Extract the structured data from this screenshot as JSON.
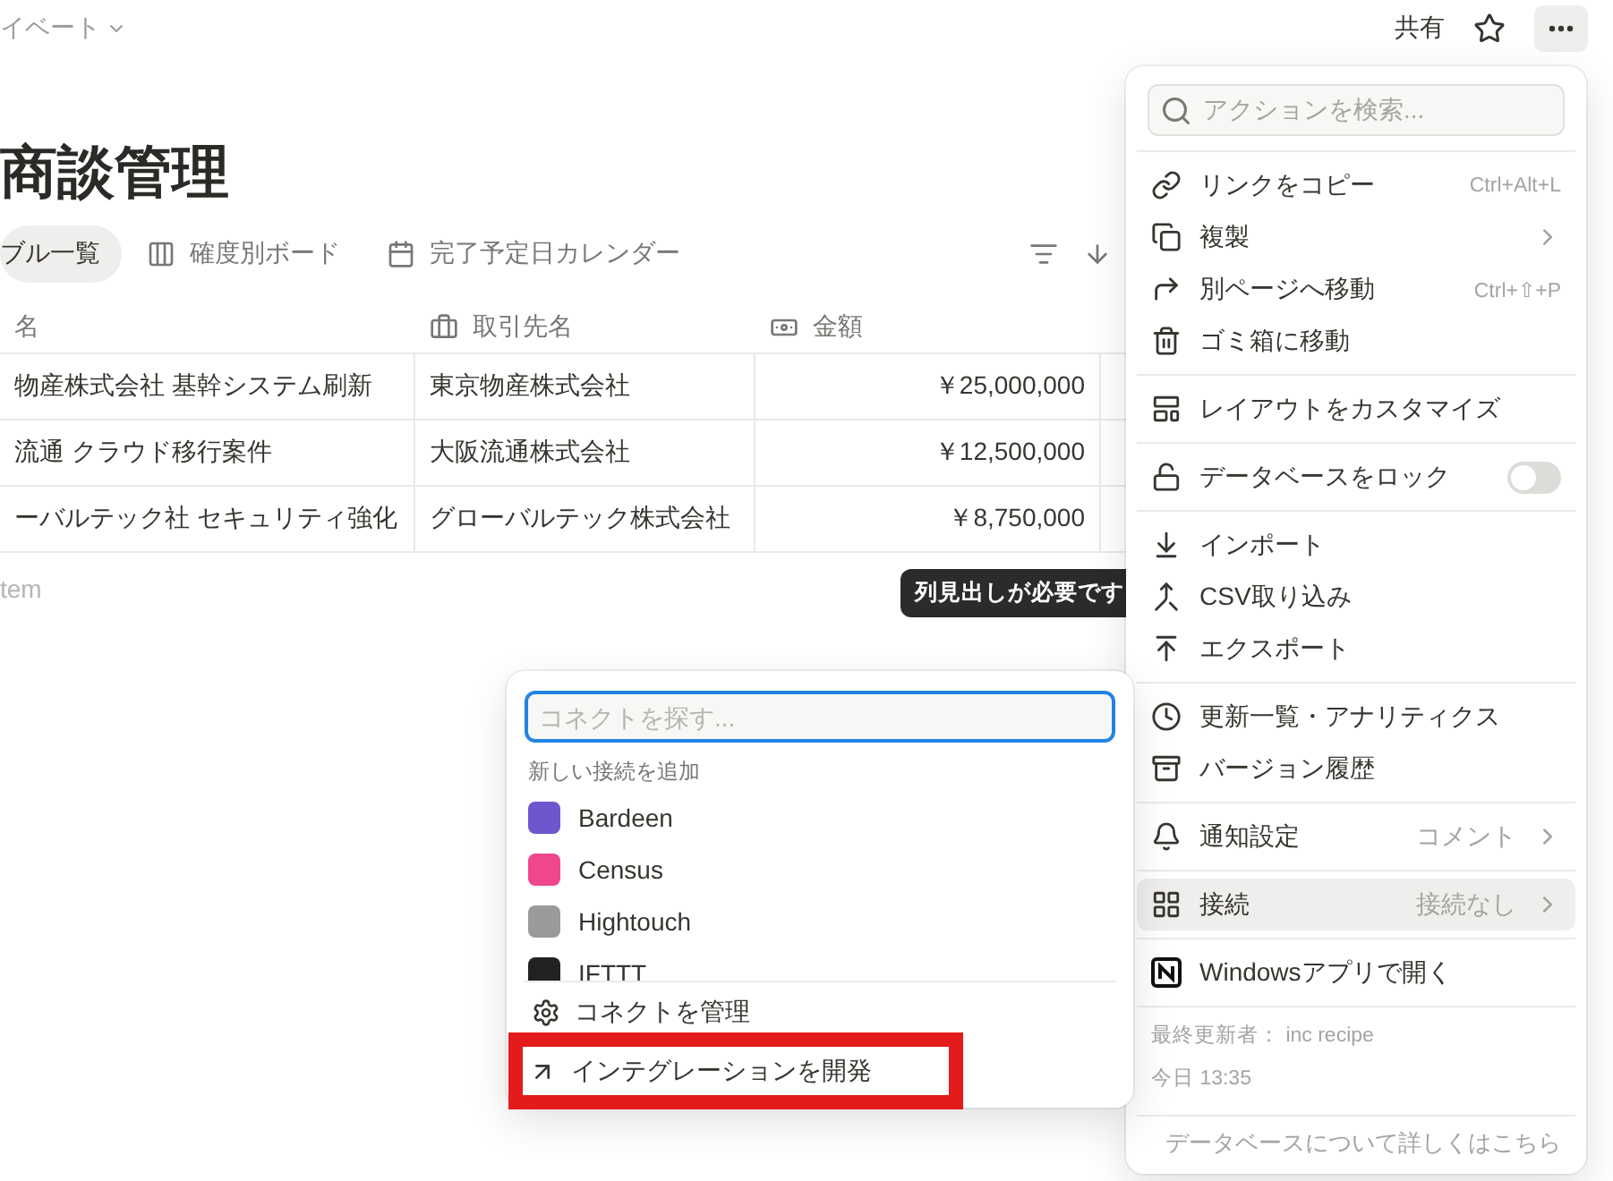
{
  "topbar": {
    "breadcrumb": "イベート",
    "share": "共有"
  },
  "title": "商談管理",
  "views": [
    {
      "label": "ブル一覧",
      "selected": true
    },
    {
      "label": "確度別ボード",
      "selected": false
    },
    {
      "label": "完了予定日カレンダー",
      "selected": false
    }
  ],
  "table": {
    "columns": [
      "名",
      "取引先名",
      "金額"
    ],
    "rows": [
      [
        "物産株式会社 基幹システム刷新",
        "東京物産株式会社",
        "￥25,000,000"
      ],
      [
        "流通 クラウド移行案件",
        "大阪流通株式会社",
        "￥12,500,000"
      ],
      [
        "ーバルテック社 セキュリティ強化",
        "グローバルテック株式会社",
        "￥8,750,000"
      ]
    ],
    "new_row": "tem"
  },
  "tooltip": "列見出しが必要です",
  "menu": {
    "search": {
      "placeholder": "アクションを検索..."
    },
    "groups": [
      [
        {
          "label": "リンクをコピー",
          "shortcut": "Ctrl+Alt+L",
          "selected": false
        },
        {
          "label": "複製",
          "submenu": true,
          "selected": false
        },
        {
          "label": "別ページへ移動",
          "shortcut": "Ctrl+⇧+P",
          "selected": false
        },
        {
          "label": "ゴミ箱に移動",
          "selected": false
        }
      ],
      [
        {
          "label": "レイアウトをカスタマイズ",
          "selected": false
        }
      ],
      [
        {
          "label": "データベースをロック",
          "kind": "toggle",
          "on": false,
          "selected": false
        }
      ],
      [
        {
          "label": "インポート",
          "selected": false
        },
        {
          "label": "CSV取り込み",
          "selected": false
        },
        {
          "label": "エクスポート",
          "selected": false
        }
      ],
      [
        {
          "label": "更新一覧・アナリティクス",
          "selected": false
        },
        {
          "label": "バージョン履歴",
          "selected": false
        }
      ],
      [
        {
          "label": "通知設定",
          "value": "コメント",
          "submenu": true,
          "selected": false
        }
      ],
      [
        {
          "label": "接続",
          "value": "接続なし",
          "submenu": true,
          "selected": true
        }
      ],
      [
        {
          "label": "Windowsアプリで開く",
          "selected": false
        }
      ]
    ],
    "last_edited": "最終更新者： inc recipe",
    "edited_time": "今日 13:35",
    "help": "データベースについて詳しくはこちら"
  },
  "connect": {
    "search": {
      "placeholder": "コネクトを探す..."
    },
    "section": "新しい接続を追加",
    "apps": [
      {
        "name": "Bardeen",
        "color": "#6e56cf"
      },
      {
        "name": "Census",
        "color": "#f0468c"
      },
      {
        "name": "Hightouch",
        "color": "#9a9a9a"
      },
      {
        "name": "IFTTT",
        "color": "#222222"
      }
    ],
    "actions": [
      {
        "label": "コネクトを管理",
        "highlighted": false
      },
      {
        "label": "インテグレーションを開発",
        "highlighted": true
      }
    ]
  }
}
